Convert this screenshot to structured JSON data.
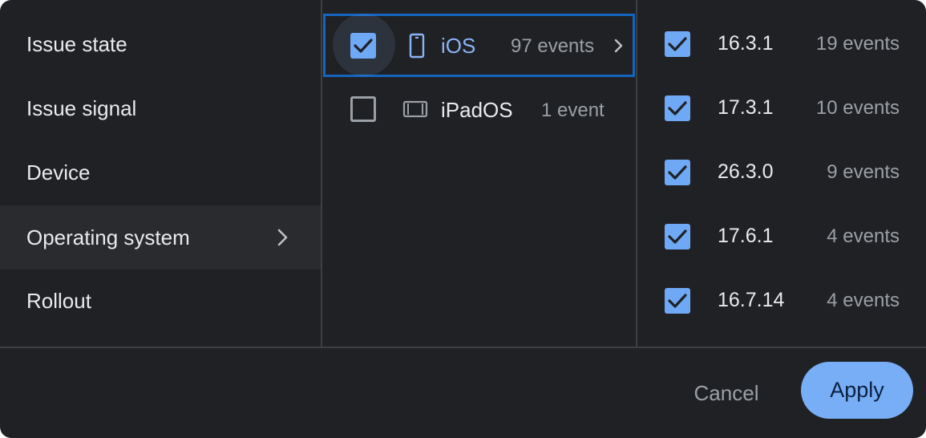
{
  "categories": [
    {
      "label": "Issue state"
    },
    {
      "label": "Issue signal"
    },
    {
      "label": "Device"
    },
    {
      "label": "Operating system"
    },
    {
      "label": "Rollout"
    }
  ],
  "active_category": "Operating system",
  "os_options": [
    {
      "name": "iOS",
      "count": "97 events",
      "checked": true,
      "icon": "phone-icon"
    },
    {
      "name": "iPadOS",
      "count": "1 event",
      "checked": false,
      "icon": "tablet-icon"
    }
  ],
  "versions": [
    {
      "name": "16.3.1",
      "count": "19 events",
      "checked": true
    },
    {
      "name": "17.3.1",
      "count": "10 events",
      "checked": true
    },
    {
      "name": "26.3.0",
      "count": "9 events",
      "checked": true
    },
    {
      "name": "17.6.1",
      "count": "4 events",
      "checked": true
    },
    {
      "name": "16.7.14",
      "count": "4 events",
      "checked": true
    }
  ],
  "footer": {
    "cancel_label": "Cancel",
    "apply_label": "Apply"
  },
  "colors": {
    "background": "#202124",
    "accent": "#8ab4f8",
    "focus_border": "#1565c0",
    "text": "#e8eaed",
    "muted": "#9aa0a6"
  }
}
